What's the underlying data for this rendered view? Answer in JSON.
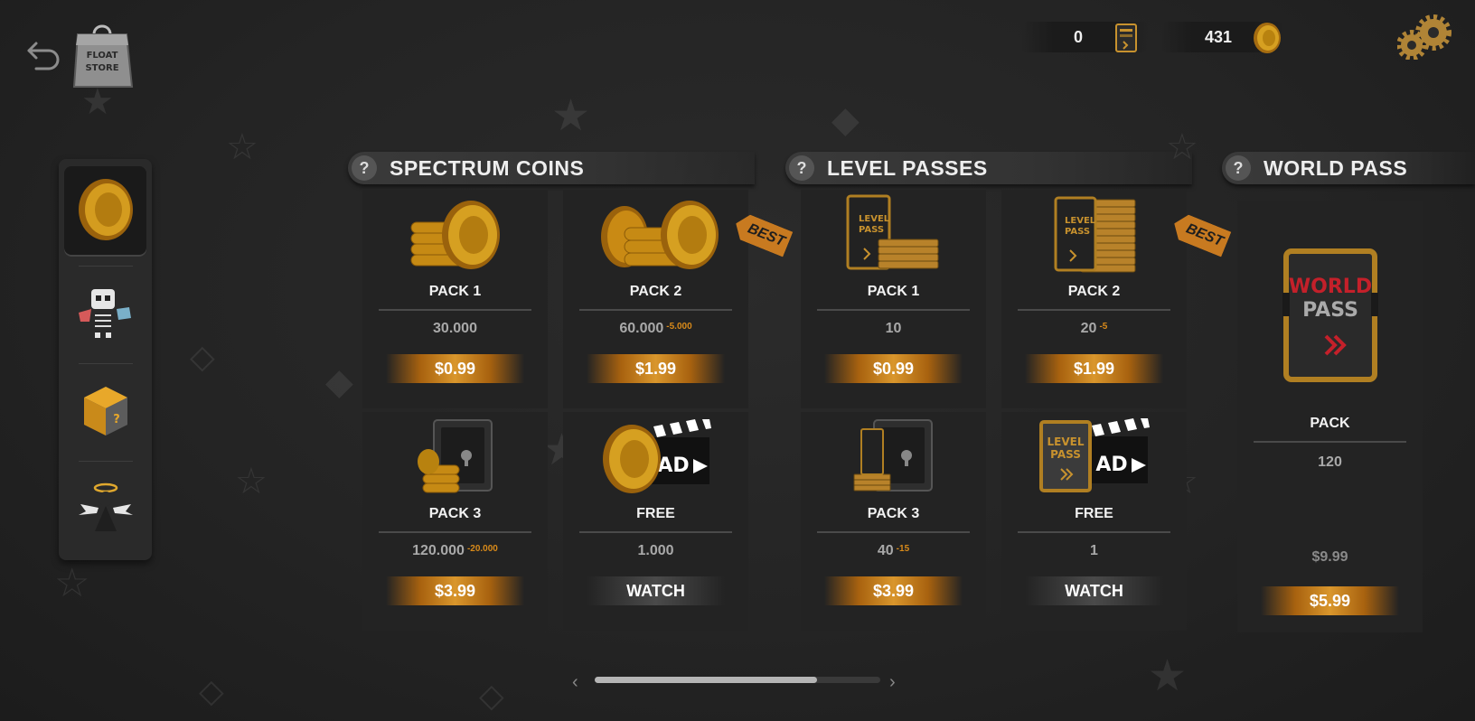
{
  "header": {
    "store_logo_text_1": "FLOAT",
    "store_logo_text_2": "STORE",
    "level_passes_balance": "0",
    "coins_balance": "431"
  },
  "sidebar": {
    "tabs": [
      {
        "name": "coins",
        "active": true
      },
      {
        "name": "skins",
        "active": false
      },
      {
        "name": "mystery-box",
        "active": false
      },
      {
        "name": "characters",
        "active": false
      }
    ]
  },
  "sections": {
    "coins_title": "SPECTRUM COINS",
    "passes_title": "LEVEL PASSES",
    "world_title": "WORLD PASS",
    "help_glyph": "?"
  },
  "coins": [
    {
      "name": "PACK 1",
      "amount": "30.000",
      "bonus": "",
      "price": "$0.99",
      "best": false
    },
    {
      "name": "PACK 2",
      "amount": "60.000",
      "bonus": "-5.000",
      "price": "$1.99",
      "best": true
    },
    {
      "name": "PACK 3",
      "amount": "120.000",
      "bonus": "-20.000",
      "price": "$3.99",
      "best": false
    },
    {
      "name": "FREE",
      "amount": "1.000",
      "bonus": "",
      "price": "WATCH",
      "best": false
    }
  ],
  "passes": [
    {
      "name": "PACK 1",
      "amount": "10",
      "bonus": "",
      "price": "$0.99",
      "best": false
    },
    {
      "name": "PACK 2",
      "amount": "20",
      "bonus": "-5",
      "price": "$1.99",
      "best": true
    },
    {
      "name": "PACK 3",
      "amount": "40",
      "bonus": "-15",
      "price": "$3.99",
      "best": false
    },
    {
      "name": "FREE",
      "amount": "1",
      "bonus": "",
      "price": "WATCH",
      "best": false
    }
  ],
  "world_pass": {
    "art_line_1": "WORLD",
    "art_line_2": "PASS",
    "name": "PACK",
    "amount": "120",
    "old_price": "$9.99",
    "price": "$5.99"
  },
  "best_label": "BEST",
  "ad_label": "AD",
  "level_pass_art_1": "LEVEL",
  "level_pass_art_2": "PASS",
  "scroll_fraction": 0.78,
  "colors": {
    "accent": "#d9962c",
    "bonus": "#d88a1a",
    "world_red": "#c4202a"
  }
}
